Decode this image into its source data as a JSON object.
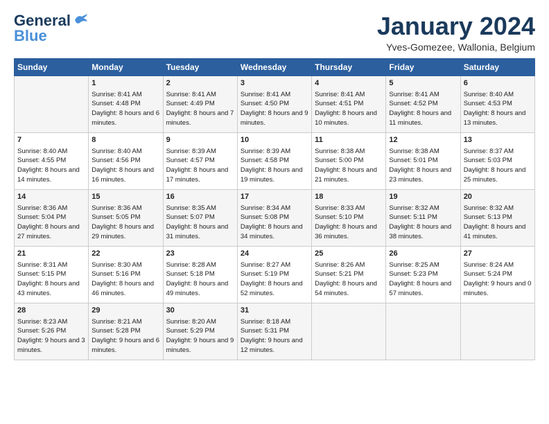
{
  "header": {
    "logo_line1": "General",
    "logo_line2": "Blue",
    "month": "January 2024",
    "location": "Yves-Gomezee, Wallonia, Belgium"
  },
  "weekdays": [
    "Sunday",
    "Monday",
    "Tuesday",
    "Wednesday",
    "Thursday",
    "Friday",
    "Saturday"
  ],
  "rows": [
    [
      {
        "day": "",
        "sunrise": "",
        "sunset": "",
        "daylight": ""
      },
      {
        "day": "1",
        "sunrise": "Sunrise: 8:41 AM",
        "sunset": "Sunset: 4:48 PM",
        "daylight": "Daylight: 8 hours and 6 minutes."
      },
      {
        "day": "2",
        "sunrise": "Sunrise: 8:41 AM",
        "sunset": "Sunset: 4:49 PM",
        "daylight": "Daylight: 8 hours and 7 minutes."
      },
      {
        "day": "3",
        "sunrise": "Sunrise: 8:41 AM",
        "sunset": "Sunset: 4:50 PM",
        "daylight": "Daylight: 8 hours and 9 minutes."
      },
      {
        "day": "4",
        "sunrise": "Sunrise: 8:41 AM",
        "sunset": "Sunset: 4:51 PM",
        "daylight": "Daylight: 8 hours and 10 minutes."
      },
      {
        "day": "5",
        "sunrise": "Sunrise: 8:41 AM",
        "sunset": "Sunset: 4:52 PM",
        "daylight": "Daylight: 8 hours and 11 minutes."
      },
      {
        "day": "6",
        "sunrise": "Sunrise: 8:40 AM",
        "sunset": "Sunset: 4:53 PM",
        "daylight": "Daylight: 8 hours and 13 minutes."
      }
    ],
    [
      {
        "day": "7",
        "sunrise": "Sunrise: 8:40 AM",
        "sunset": "Sunset: 4:55 PM",
        "daylight": "Daylight: 8 hours and 14 minutes."
      },
      {
        "day": "8",
        "sunrise": "Sunrise: 8:40 AM",
        "sunset": "Sunset: 4:56 PM",
        "daylight": "Daylight: 8 hours and 16 minutes."
      },
      {
        "day": "9",
        "sunrise": "Sunrise: 8:39 AM",
        "sunset": "Sunset: 4:57 PM",
        "daylight": "Daylight: 8 hours and 17 minutes."
      },
      {
        "day": "10",
        "sunrise": "Sunrise: 8:39 AM",
        "sunset": "Sunset: 4:58 PM",
        "daylight": "Daylight: 8 hours and 19 minutes."
      },
      {
        "day": "11",
        "sunrise": "Sunrise: 8:38 AM",
        "sunset": "Sunset: 5:00 PM",
        "daylight": "Daylight: 8 hours and 21 minutes."
      },
      {
        "day": "12",
        "sunrise": "Sunrise: 8:38 AM",
        "sunset": "Sunset: 5:01 PM",
        "daylight": "Daylight: 8 hours and 23 minutes."
      },
      {
        "day": "13",
        "sunrise": "Sunrise: 8:37 AM",
        "sunset": "Sunset: 5:03 PM",
        "daylight": "Daylight: 8 hours and 25 minutes."
      }
    ],
    [
      {
        "day": "14",
        "sunrise": "Sunrise: 8:36 AM",
        "sunset": "Sunset: 5:04 PM",
        "daylight": "Daylight: 8 hours and 27 minutes."
      },
      {
        "day": "15",
        "sunrise": "Sunrise: 8:36 AM",
        "sunset": "Sunset: 5:05 PM",
        "daylight": "Daylight: 8 hours and 29 minutes."
      },
      {
        "day": "16",
        "sunrise": "Sunrise: 8:35 AM",
        "sunset": "Sunset: 5:07 PM",
        "daylight": "Daylight: 8 hours and 31 minutes."
      },
      {
        "day": "17",
        "sunrise": "Sunrise: 8:34 AM",
        "sunset": "Sunset: 5:08 PM",
        "daylight": "Daylight: 8 hours and 34 minutes."
      },
      {
        "day": "18",
        "sunrise": "Sunrise: 8:33 AM",
        "sunset": "Sunset: 5:10 PM",
        "daylight": "Daylight: 8 hours and 36 minutes."
      },
      {
        "day": "19",
        "sunrise": "Sunrise: 8:32 AM",
        "sunset": "Sunset: 5:11 PM",
        "daylight": "Daylight: 8 hours and 38 minutes."
      },
      {
        "day": "20",
        "sunrise": "Sunrise: 8:32 AM",
        "sunset": "Sunset: 5:13 PM",
        "daylight": "Daylight: 8 hours and 41 minutes."
      }
    ],
    [
      {
        "day": "21",
        "sunrise": "Sunrise: 8:31 AM",
        "sunset": "Sunset: 5:15 PM",
        "daylight": "Daylight: 8 hours and 43 minutes."
      },
      {
        "day": "22",
        "sunrise": "Sunrise: 8:30 AM",
        "sunset": "Sunset: 5:16 PM",
        "daylight": "Daylight: 8 hours and 46 minutes."
      },
      {
        "day": "23",
        "sunrise": "Sunrise: 8:28 AM",
        "sunset": "Sunset: 5:18 PM",
        "daylight": "Daylight: 8 hours and 49 minutes."
      },
      {
        "day": "24",
        "sunrise": "Sunrise: 8:27 AM",
        "sunset": "Sunset: 5:19 PM",
        "daylight": "Daylight: 8 hours and 52 minutes."
      },
      {
        "day": "25",
        "sunrise": "Sunrise: 8:26 AM",
        "sunset": "Sunset: 5:21 PM",
        "daylight": "Daylight: 8 hours and 54 minutes."
      },
      {
        "day": "26",
        "sunrise": "Sunrise: 8:25 AM",
        "sunset": "Sunset: 5:23 PM",
        "daylight": "Daylight: 8 hours and 57 minutes."
      },
      {
        "day": "27",
        "sunrise": "Sunrise: 8:24 AM",
        "sunset": "Sunset: 5:24 PM",
        "daylight": "Daylight: 9 hours and 0 minutes."
      }
    ],
    [
      {
        "day": "28",
        "sunrise": "Sunrise: 8:23 AM",
        "sunset": "Sunset: 5:26 PM",
        "daylight": "Daylight: 9 hours and 3 minutes."
      },
      {
        "day": "29",
        "sunrise": "Sunrise: 8:21 AM",
        "sunset": "Sunset: 5:28 PM",
        "daylight": "Daylight: 9 hours and 6 minutes."
      },
      {
        "day": "30",
        "sunrise": "Sunrise: 8:20 AM",
        "sunset": "Sunset: 5:29 PM",
        "daylight": "Daylight: 9 hours and 9 minutes."
      },
      {
        "day": "31",
        "sunrise": "Sunrise: 8:18 AM",
        "sunset": "Sunset: 5:31 PM",
        "daylight": "Daylight: 9 hours and 12 minutes."
      },
      {
        "day": "",
        "sunrise": "",
        "sunset": "",
        "daylight": ""
      },
      {
        "day": "",
        "sunrise": "",
        "sunset": "",
        "daylight": ""
      },
      {
        "day": "",
        "sunrise": "",
        "sunset": "",
        "daylight": ""
      }
    ]
  ]
}
